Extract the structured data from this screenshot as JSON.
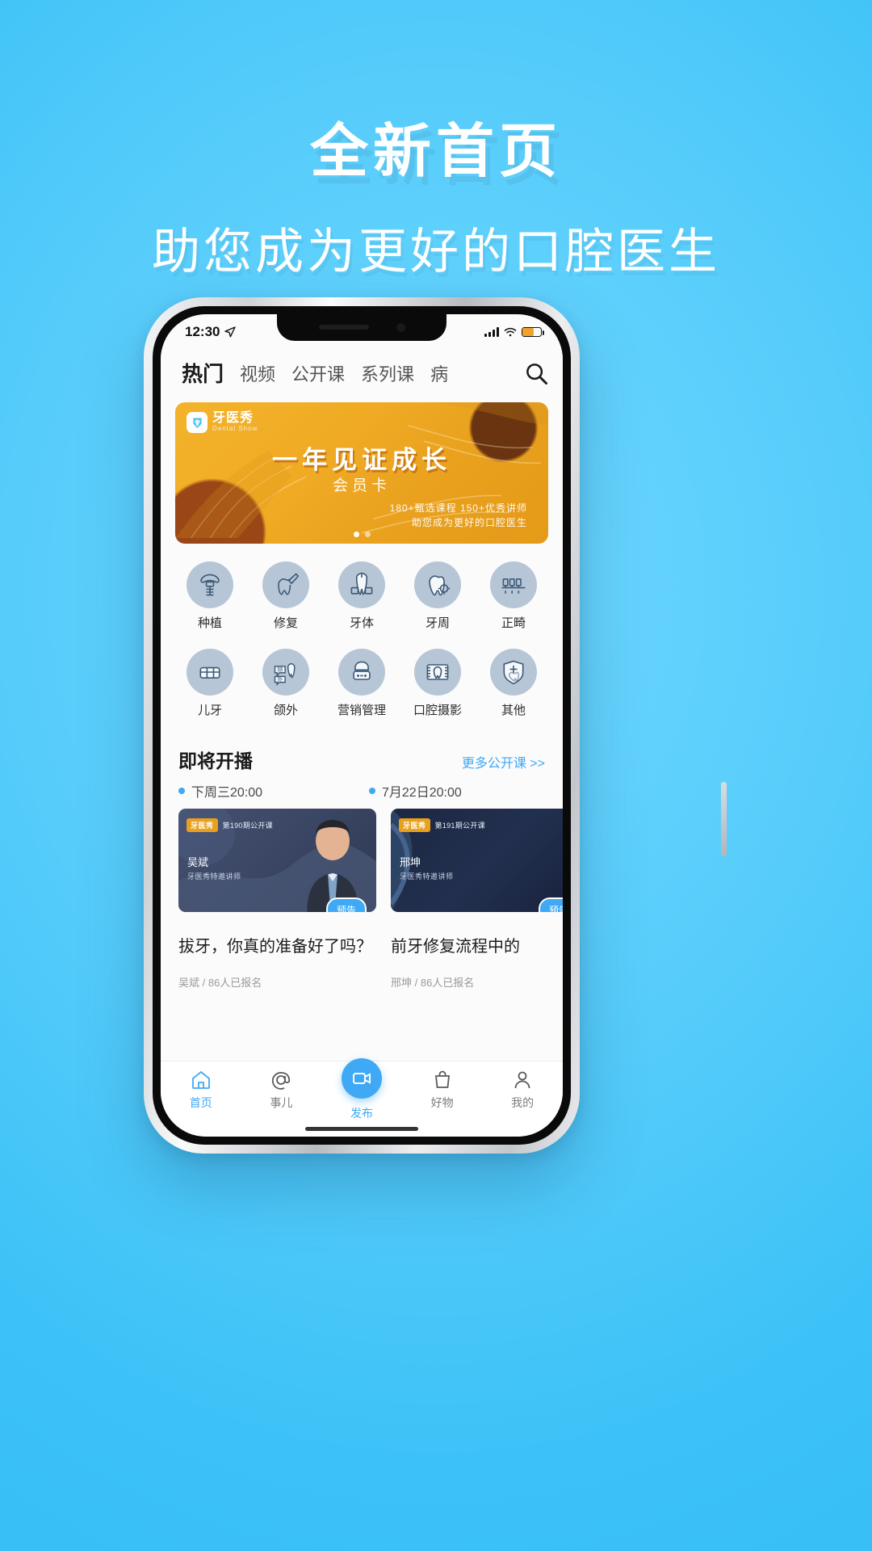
{
  "promo": {
    "title": "全新首页",
    "subtitle": "助您成为更好的口腔医生",
    "bg_color": "#4ecbf9"
  },
  "status_bar": {
    "time": "12:30",
    "location_icon": "location-arrow-icon",
    "signal_icon": "cellular-signal-icon",
    "wifi_icon": "wifi-icon",
    "battery_icon": "battery-icon"
  },
  "tabs": {
    "items": [
      {
        "label": "热门",
        "active": true
      },
      {
        "label": "视频",
        "active": false
      },
      {
        "label": "公开课",
        "active": false
      },
      {
        "label": "系列课",
        "active": false
      },
      {
        "label": "病",
        "active": false
      }
    ],
    "search_icon": "search-icon"
  },
  "banner": {
    "logo_cn": "牙医秀",
    "logo_en": "Dental Show",
    "title": "一年见证成长",
    "subtitle": "会员卡",
    "line1": "180+甄选课程 150+优秀讲师",
    "line2": "助您成为更好的口腔医生",
    "accent_color": "#e8a01d",
    "dots_total": 2,
    "dots_active": 1
  },
  "categories": [
    {
      "label": "种植",
      "icon": "dental-implant-icon"
    },
    {
      "label": "修复",
      "icon": "tooth-restoration-icon"
    },
    {
      "label": "牙体",
      "icon": "tooth-body-icon"
    },
    {
      "label": "牙周",
      "icon": "periodontal-icon"
    },
    {
      "label": "正畸",
      "icon": "braces-icon"
    },
    {
      "label": "儿牙",
      "icon": "child-teeth-icon"
    },
    {
      "label": "颌外",
      "icon": "maxillofacial-icon"
    },
    {
      "label": "营销管理",
      "icon": "dentist-management-icon"
    },
    {
      "label": "口腔摄影",
      "icon": "oral-photography-icon"
    },
    {
      "label": "其他",
      "icon": "shield-tooth-icon"
    }
  ],
  "live_section": {
    "title": "即将开播",
    "more_label": "更多公开课 >>",
    "more_color": "#3fa9f5",
    "cards": [
      {
        "time": "下周三20:00",
        "badge_brand": "牙医秀",
        "badge_episode": "第190期公开课",
        "speaker": "吴斌",
        "speaker_role": "牙医秀特邀讲师",
        "pill": "预告",
        "title": "拔牙，你真的准备好了吗？",
        "meta": "吴斌 / 86人已报名"
      },
      {
        "time": "7月22日20:00",
        "badge_brand": "牙医秀",
        "badge_episode": "第191期公开课",
        "speaker": "邢坤",
        "speaker_role": "牙医秀特邀讲师",
        "pill": "预告",
        "title": "前牙修复流程中的",
        "meta": "邢坤 / 86人已报名"
      }
    ]
  },
  "bottom_nav": {
    "items": [
      {
        "label": "首页",
        "icon": "home-icon",
        "active": true
      },
      {
        "label": "事儿",
        "icon": "at-sign-icon",
        "active": false
      },
      {
        "label": "发布",
        "icon": "video-camera-icon",
        "active": false,
        "primary": true
      },
      {
        "label": "好物",
        "icon": "shopping-bag-icon",
        "active": false
      },
      {
        "label": "我的",
        "icon": "person-icon",
        "active": false
      }
    ],
    "active_color": "#3fa9f5"
  }
}
